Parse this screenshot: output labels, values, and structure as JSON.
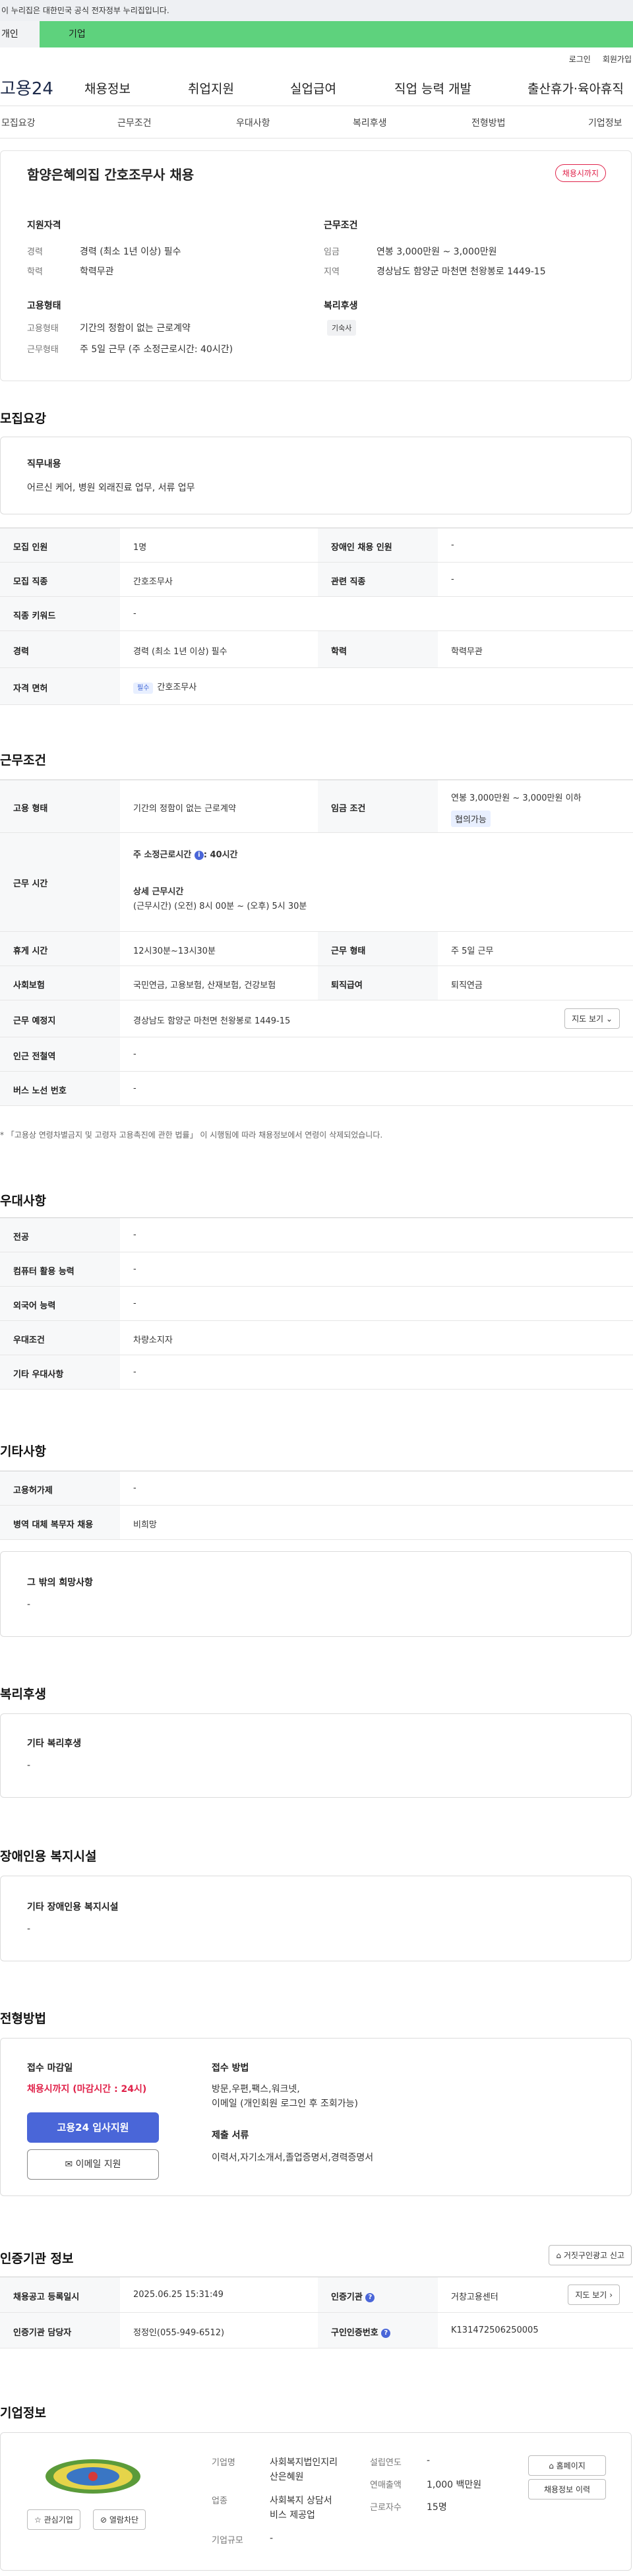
{
  "banner": {
    "gov_notice": "이 누리집은 대한민국 공식 전자정부 누리집입니다."
  },
  "usertype": {
    "personal": "개인",
    "company": "기업"
  },
  "util": {
    "login": "로그인",
    "join": "회원가입"
  },
  "gnb": {
    "logo": "고용24",
    "menu": [
      "채용정보",
      "취업지원",
      "실업급여",
      "직업 능력 개발",
      "출산휴가·육아휴직"
    ]
  },
  "subtabs": [
    "모집요강",
    "근무조건",
    "우대사항",
    "복리후생",
    "전형방법",
    "기업정보"
  ],
  "summary": {
    "title": "함양은혜의집 간호조무사 채용",
    "badge": "채용시까지",
    "qual_heading": "지원자격",
    "career_label": "경력",
    "career_value": "경력 (최소 1년 이상) 필수",
    "edu_label": "학력",
    "edu_value": "학력무관",
    "work_heading": "근무조건",
    "wage_label": "임금",
    "wage_value": "연봉 3,000만원 ~ 3,000만원",
    "region_label": "지역",
    "region_value": "경상남도 함양군 마천면 천왕봉로 1449-15",
    "emp_heading": "고용형태",
    "emp_label": "고용형태",
    "emp_value": "기간의 정함이 없는 근로계약",
    "worktype_label": "근무형태",
    "worktype_value": "주 5일 근무 (주 소정근로시간: 40시간)",
    "welfare_heading": "복리후생",
    "welfare_chip": "기숙사"
  },
  "recruit": {
    "heading": "모집요강",
    "duty_heading": "직무내용",
    "duty_value": "어르신 케어, 병원 외래진료 업무, 서류 업무",
    "rows": {
      "count_label": "모집 인원",
      "count_value": "1명",
      "disabled_label": "장애인 채용 인원",
      "disabled_value": "-",
      "job_label": "모집 직종",
      "job_value": "간호조무사",
      "related_label": "관련 직종",
      "related_value": "-",
      "keyword_label": "직종 키워드",
      "keyword_value": "-",
      "career_label": "경력",
      "career_value": "경력 (최소 1년 이상) 필수",
      "edu_label": "학력",
      "edu_value": "학력무관",
      "license_label": "자격 면허",
      "license_tag": "필수",
      "license_value": "간호조무사"
    }
  },
  "conditions": {
    "heading": "근무조건",
    "emp_label": "고용 형태",
    "emp_value": "기간의 정함이 없는 근로계약",
    "wage_label": "임금 조건",
    "wage_value": "연봉 3,000만원 ~ 3,000만원 이하",
    "wage_tag": "협의가능",
    "hours_label": "근무 시간",
    "hours_std": "주 소정근로시간 ",
    "hours_std_value": ": 40시간",
    "hours_detail_heading": "상세 근무시간",
    "hours_detail": "(근무시간) (오전) 8시 00분 ~ (오후) 5시 30분",
    "break_label": "휴게 시간",
    "break_value": "12시30분~13시30분",
    "worktype_label": "근무 형태",
    "worktype_value": "주 5일 근무",
    "insurance_label": "사회보험",
    "insurance_value": "국민연금, 고용보험, 산재보험, 건강보험",
    "pension_label": "퇴직급여",
    "pension_value": "퇴직연금",
    "place_label": "근무 예정지",
    "place_value": "경상남도 함양군 마천면 천왕봉로 1449-15",
    "map_btn": "지도 보기",
    "subway_label": "인근 전철역",
    "subway_value": "-",
    "bus_label": "버스 노선 번호",
    "bus_value": "-",
    "note": "* 「고용상 연령차별금지 및 고령자 고용촉진에 관한 법률」 이 시행됨에 따라 채용정보에서 연령이 삭제되었습니다."
  },
  "preference": {
    "heading": "우대사항",
    "major_label": "전공",
    "major_value": "-",
    "computer_label": "컴퓨터 활용 능력",
    "computer_value": "-",
    "language_label": "외국어 능력",
    "language_value": "-",
    "cond_label": "우대조건",
    "cond_value": "차량소지자",
    "etc_label": "기타 우대사항",
    "etc_value": "-"
  },
  "other": {
    "heading": "기타사항",
    "permit_label": "고용허가제",
    "permit_value": "-",
    "military_label": "병역 대체 복무자 채용",
    "military_value": "비희망",
    "extra_heading": "그 밖의 희망사항",
    "extra_value": "-"
  },
  "welfare": {
    "heading": "복리후생",
    "sub": "기타 복리후생",
    "value": "-"
  },
  "disability": {
    "heading": "장애인용 복지시설",
    "sub": "기타 장애인용 복지시설",
    "value": "-"
  },
  "screening": {
    "heading": "전형방법",
    "deadline_heading": "접수 마감일",
    "deadline_value": "채용시까지 (마감시간 : 24시)",
    "apply_btn": "고용24 입사지원",
    "email_btn": "이메일 지원",
    "method_heading": "접수 방법",
    "method_value_1": "방문,우편,팩스,워크넷,",
    "method_value_2": "이메일 (개인회원 로그인 후 조회가능)",
    "docs_heading": "제출 서류",
    "docs_value": "이력서,자기소개서,졸업증명서,경력증명서"
  },
  "agency": {
    "heading": "인증기관 정보",
    "report_btn": "거짓구인광고 신고",
    "date_label": "채용공고 등록일시",
    "date_value": "2025.06.25 15:31:49",
    "agency_label": "인증기관",
    "agency_value": "거창고용센터",
    "map_btn": "지도 보기",
    "manager_label": "인증기관 담당자",
    "manager_value": "정정인(055-949-6512)",
    "number_label": "구인인증번호",
    "number_value": "K131472506250005"
  },
  "company": {
    "heading": "기업정보",
    "interest_btn": "관심기업",
    "block_btn": "열람차단",
    "name_label": "기업명",
    "name_value_1": "사회복지법인지리",
    "name_value_2": "산은혜원",
    "industry_label": "업종",
    "industry_value_1": "사회복지 상담서",
    "industry_value_2": "비스 제공업",
    "size_label": "기업규모",
    "size_value": "-",
    "founded_label": "설립연도",
    "founded_value": "-",
    "sales_label": "연매출액",
    "sales_value": "1,000 백만원",
    "employees_label": "근로자수",
    "employees_value": "15명",
    "homepage_btn": "홈페이지",
    "history_btn": "채용정보 이력"
  },
  "colors": {
    "accent_blue": "#4a66d8",
    "badge_red": "#e0224a",
    "company_green": "#5ed27d"
  }
}
